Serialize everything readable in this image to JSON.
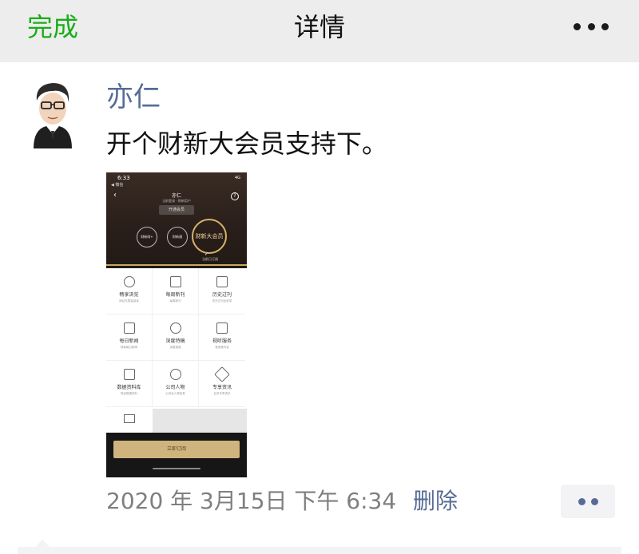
{
  "navbar": {
    "done_label": "完成",
    "title": "详情",
    "more_icon": "more-dots-icon"
  },
  "post": {
    "author": "亦仁",
    "text": "开个财新大会员支持下。",
    "timestamp": "2020 年 3月15日 下午 6:34",
    "delete_label": "删除",
    "actions_icon": "comment-like-dots-icon"
  },
  "screenshot": {
    "status_time": "6:33",
    "status_signal": "4G",
    "back_app": "◀ 微信",
    "profile_name": "亦仁",
    "profile_sub": "当前登录 · 财新用户",
    "pill_label": "开通会员",
    "badges": [
      "财新网+",
      "财新通",
      "财新大会员"
    ],
    "selected_label": "当前已订阅",
    "grid": [
      {
        "title": "畅享浏览",
        "sub": "网站无限量阅读",
        "icon": "clock-icon"
      },
      {
        "title": "每周新刊",
        "sub": "每周新刊",
        "icon": "magazine-icon"
      },
      {
        "title": "历史过刊",
        "sub": "历史过刊全收录",
        "icon": "archive-icon"
      },
      {
        "title": "每日新闻",
        "sub": "财新每日新闻",
        "icon": "news-icon"
      },
      {
        "title": "深度特稿",
        "sub": "深度报道",
        "icon": "search-icon"
      },
      {
        "title": "视听服务",
        "sub": "音视频内容",
        "icon": "audio-icon"
      },
      {
        "title": "数据资料库",
        "sub": "财经数据资料",
        "icon": "folder-icon"
      },
      {
        "title": "公司人物",
        "sub": "公司及人物信息",
        "icon": "person-icon"
      },
      {
        "title": "专享资讯",
        "sub": "会员专享资讯",
        "icon": "diamond-icon"
      }
    ],
    "subscribe_label": "立即订阅"
  }
}
